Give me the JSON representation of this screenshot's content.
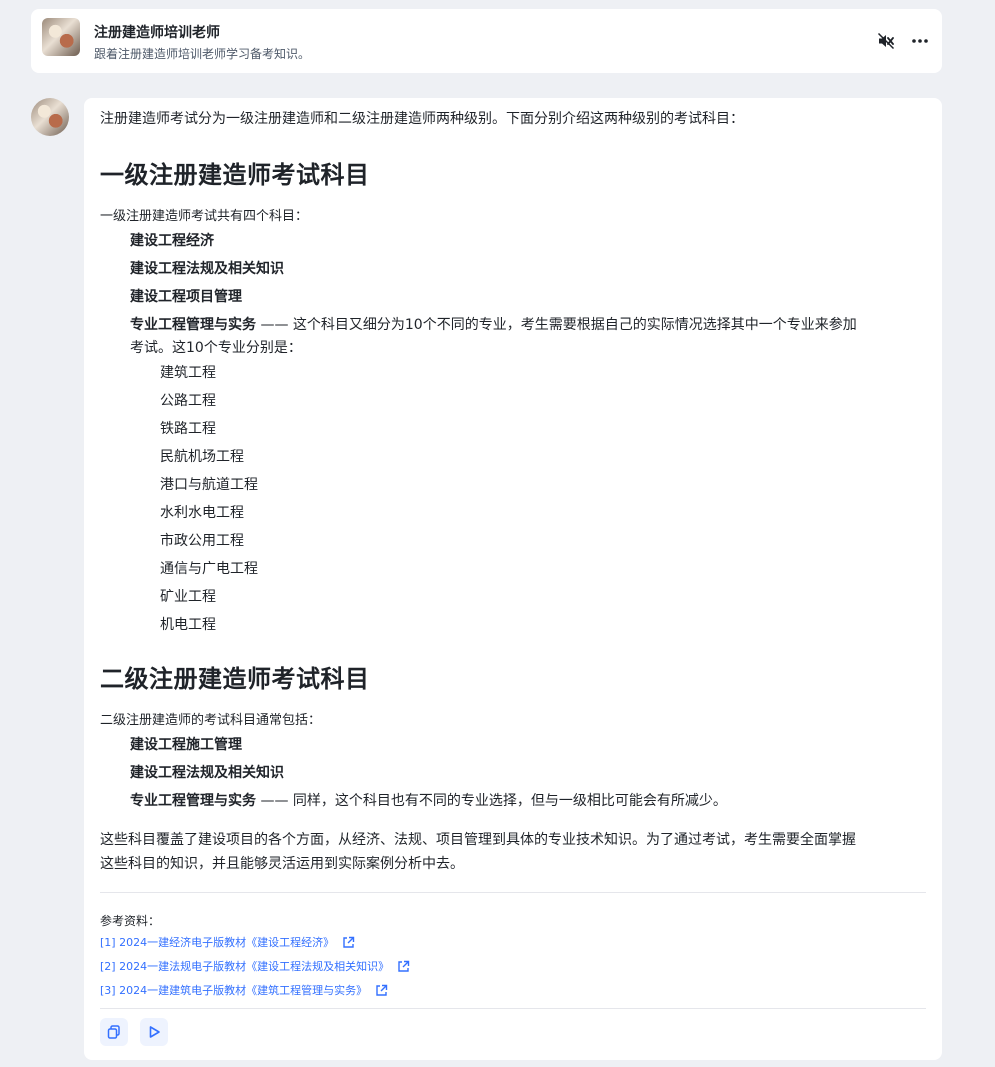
{
  "header": {
    "title": "注册建造师培训老师",
    "subtitle": "跟着注册建造师培训老师学习备考知识。"
  },
  "message": {
    "intro": "注册建造师考试分为一级注册建造师和二级注册建造师两种级别。下面分别介绍这两种级别的考试科目：",
    "level1": {
      "heading": "一级注册建造师考试科目",
      "lead": "一级注册建造师考试共有四个科目：",
      "subjects": [
        "建设工程经济",
        "建设工程法规及相关知识",
        "建设工程项目管理"
      ],
      "practice_bold": "专业工程管理与实务",
      "practice_desc_line1": " —— 这个科目又细分为10个不同的专业，考生需要根据自己的实际情况选择其中一个专业来参加",
      "practice_desc_line2": "考试。这10个专业分别是：",
      "specialties": [
        "建筑工程",
        "公路工程",
        "铁路工程",
        "民航机场工程",
        "港口与航道工程",
        "水利水电工程",
        "市政公用工程",
        "通信与广电工程",
        "矿业工程",
        "机电工程"
      ]
    },
    "level2": {
      "heading": "二级注册建造师考试科目",
      "lead": "二级注册建造师的考试科目通常包括：",
      "subjects": [
        "建设工程施工管理",
        "建设工程法规及相关知识"
      ],
      "practice_bold": "专业工程管理与实务",
      "practice_desc": " —— 同样，这个科目也有不同的专业选择，但与一级相比可能会有所减少。"
    },
    "summary_line1": "这些科目覆盖了建设项目的各个方面，从经济、法规、项目管理到具体的专业技术知识。为了通过考试，考生需要全面掌握",
    "summary_line2": "这些科目的知识，并且能够灵活运用到实际案例分析中去。",
    "refs_label": "参考资料：",
    "refs": [
      "[1] 2024一建经济电子版教材《建设工程经济》",
      "[2] 2024一建法规电子版教材《建设工程法规及相关知识》",
      "[3] 2024一建建筑电子版教材《建筑工程管理与实务》"
    ]
  },
  "icons": {
    "mute": "speaker-muted-icon",
    "more": "more-icon",
    "copy": "copy-icon",
    "play": "play-icon",
    "external": "external-link-icon"
  },
  "colors": {
    "link": "#3370ff",
    "action_bg": "#eef3fe",
    "page_bg": "#eef0f4"
  }
}
